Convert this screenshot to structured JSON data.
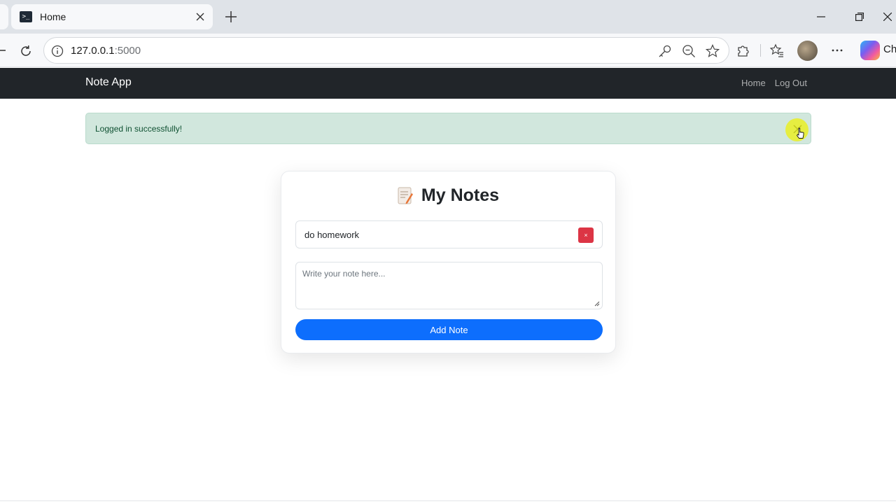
{
  "browser": {
    "tab": {
      "title": "Home",
      "favicon": "terminal-icon"
    },
    "address": {
      "host": "127.0.0.1",
      "port": ":5000"
    },
    "copilot_label": "Ch"
  },
  "navbar": {
    "brand": "Note App",
    "links": [
      "Home",
      "Log Out"
    ]
  },
  "alert": {
    "message": "Logged in successfully!",
    "color": "#d1e7dd"
  },
  "card": {
    "title": "My Notes",
    "title_icon": "memo-icon",
    "notes": [
      {
        "text": "do homework",
        "delete_label": "×"
      }
    ],
    "textarea_placeholder": "Write your note here...",
    "add_button": "Add Note"
  },
  "colors": {
    "navbar": "#212529",
    "primary": "#0d6efd",
    "danger": "#dc3545",
    "success_bg": "#d1e7dd"
  }
}
